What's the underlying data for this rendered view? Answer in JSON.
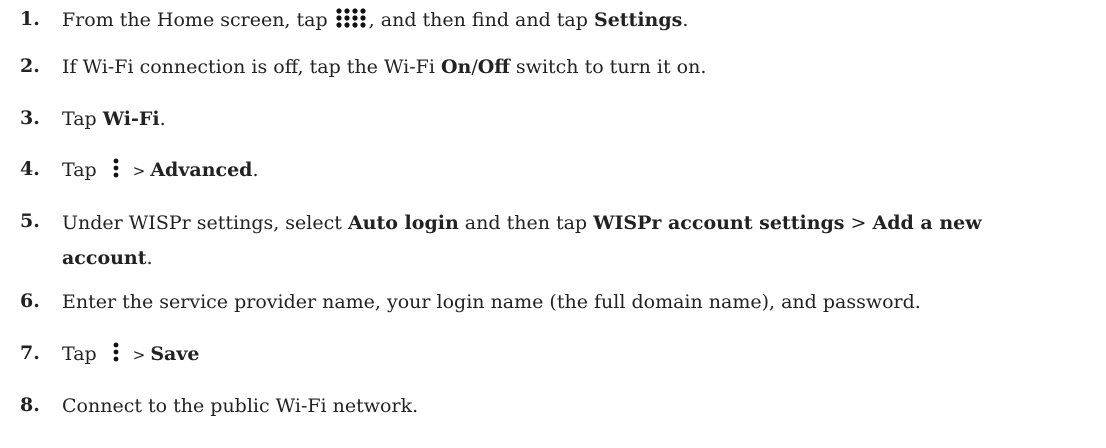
{
  "steps": [
    {
      "number": "1.",
      "parts": [
        {
          "kind": "text",
          "value": "From the Home screen, tap "
        },
        {
          "kind": "icon",
          "icon": "app-grid-icon"
        },
        {
          "kind": "text",
          "value": ", and then find and tap "
        },
        {
          "kind": "bold",
          "value": "Settings"
        },
        {
          "kind": "text",
          "value": "."
        }
      ]
    },
    {
      "number": "2.",
      "parts": [
        {
          "kind": "text",
          "value": "If Wi-Fi connection is off, tap the Wi-Fi "
        },
        {
          "kind": "bold",
          "value": "On"
        },
        {
          "kind": "text",
          "value": "/"
        },
        {
          "kind": "bold",
          "value": "Off"
        },
        {
          "kind": "text",
          "value": " switch to turn it on."
        }
      ]
    },
    {
      "number": "3.",
      "parts": [
        {
          "kind": "text",
          "value": "Tap "
        },
        {
          "kind": "bold",
          "value": "Wi-Fi"
        },
        {
          "kind": "text",
          "value": "."
        }
      ]
    },
    {
      "number": "4.",
      "parts": [
        {
          "kind": "text",
          "value": "Tap "
        },
        {
          "kind": "icon",
          "icon": "more-vertical-icon"
        },
        {
          "kind": "sep",
          "value": ">"
        },
        {
          "kind": "bold",
          "value": "Advanced"
        },
        {
          "kind": "text",
          "value": "."
        }
      ]
    },
    {
      "number": "5.",
      "parts": [
        {
          "kind": "text",
          "value": "Under WISPr settings, select "
        },
        {
          "kind": "bold",
          "value": "Auto login"
        },
        {
          "kind": "text",
          "value": " and then tap "
        },
        {
          "kind": "bold",
          "value": "WISPr account settings"
        },
        {
          "kind": "text",
          "value": " > "
        },
        {
          "kind": "bold",
          "value": "Add a new"
        },
        {
          "kind": "break"
        },
        {
          "kind": "bold",
          "value": "account"
        },
        {
          "kind": "text",
          "value": "."
        }
      ]
    },
    {
      "number": "6.",
      "parts": [
        {
          "kind": "text",
          "value": "Enter the service provider name, your login name (the full domain name), and password."
        }
      ]
    },
    {
      "number": "7.",
      "parts": [
        {
          "kind": "text",
          "value": "Tap "
        },
        {
          "kind": "icon",
          "icon": "more-vertical-icon"
        },
        {
          "kind": "sep",
          "value": ">"
        },
        {
          "kind": "bold",
          "value": "Save"
        }
      ]
    },
    {
      "number": "8.",
      "parts": [
        {
          "kind": "text",
          "value": "Connect to the public Wi-Fi network."
        }
      ]
    }
  ]
}
